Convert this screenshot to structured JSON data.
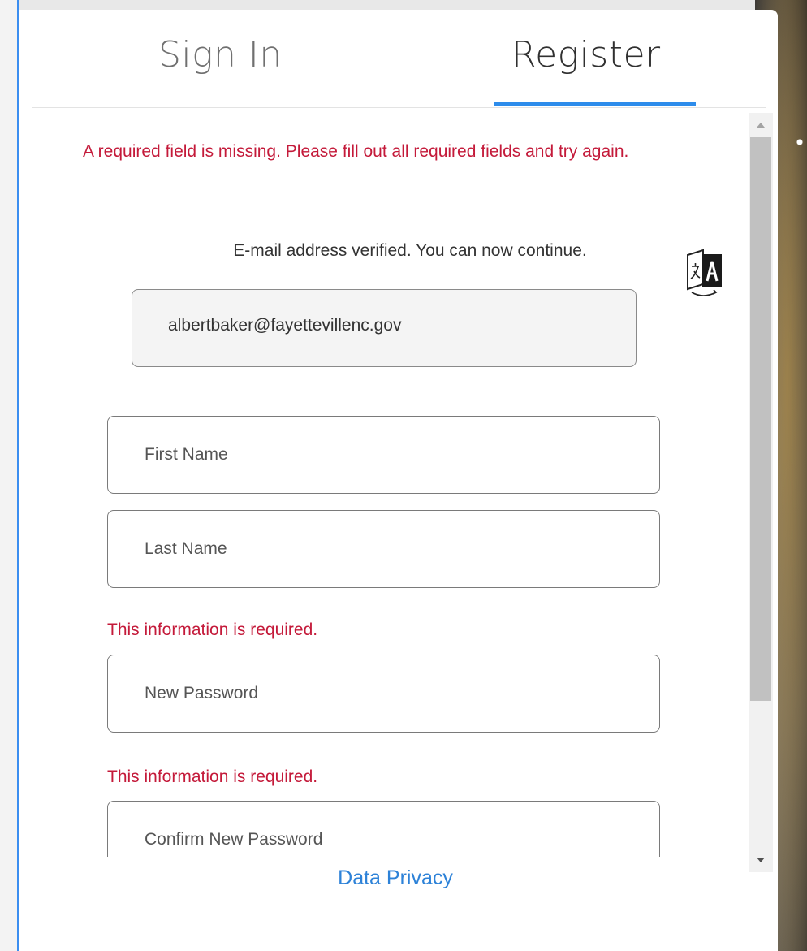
{
  "tabs": {
    "sign_in": "Sign In",
    "register": "Register",
    "active": "Register"
  },
  "form": {
    "error_banner": "A required field is missing. Please fill out all required fields and try again.",
    "verified_message": "E-mail address verified. You can now continue.",
    "email_value": "albertbaker@fayettevillenc.gov",
    "first_name_placeholder": "First Name",
    "last_name_placeholder": "Last Name",
    "password_required_msg": "This information is required.",
    "new_password_placeholder": "New Password",
    "confirm_required_msg": "This information is required.",
    "confirm_password_placeholder": "Confirm New Password"
  },
  "footer": {
    "privacy_link": "Data Privacy"
  },
  "icons": {
    "language": "translate-icon"
  },
  "colors": {
    "accent": "#2d8ceb",
    "error": "#c41a3a",
    "link": "#2d82d8"
  }
}
